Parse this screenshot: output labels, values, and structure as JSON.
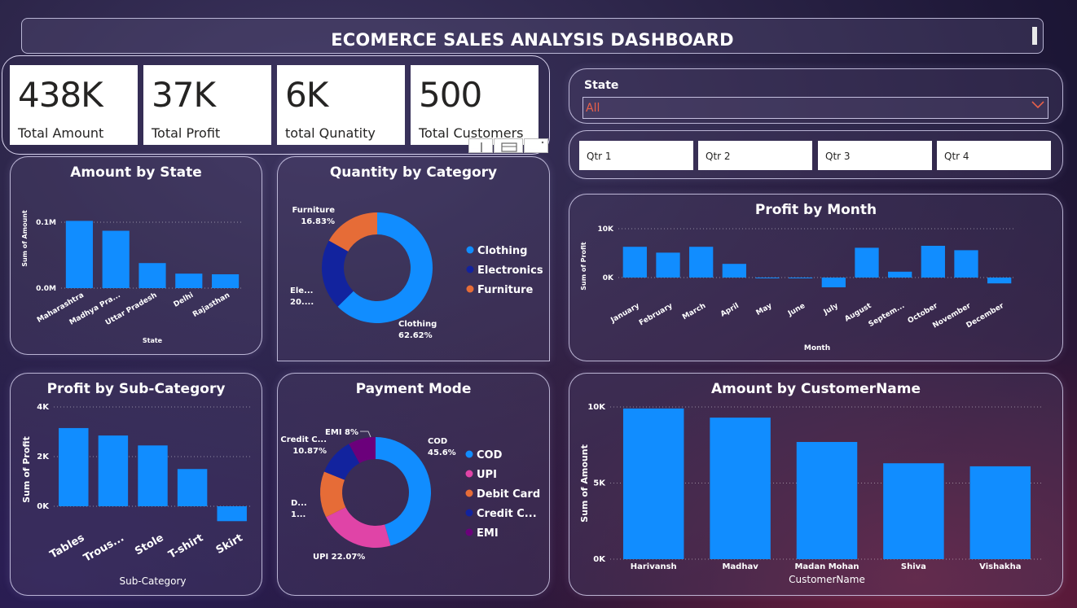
{
  "title": "ECOMERCE SALES ANALYSIS DASHBOARD",
  "kpis": [
    {
      "value": "438K",
      "label": "Total Amount"
    },
    {
      "value": "37K",
      "label": "Total Profit"
    },
    {
      "value": "6K",
      "label": "total Qunatity"
    },
    {
      "value": "500",
      "label": "Total Customers"
    }
  ],
  "state_slicer": {
    "label": "State",
    "selected": "All"
  },
  "quarters": [
    "Qtr 1",
    "Qtr 2",
    "Qtr 3",
    "Qtr 4"
  ],
  "colors": {
    "bar": "#118DFF",
    "clothing": "#118DFF",
    "electronics": "#12239E",
    "furniture": "#E66C37",
    "cod": "#118DFF",
    "upi": "#E044A7",
    "debit": "#E66C37",
    "credit": "#12239E",
    "emi": "#6B007B"
  },
  "chart_data": [
    {
      "id": "amount_by_state",
      "type": "bar",
      "title": "Amount by State",
      "xlabel": "State",
      "ylabel": "Sum of Amount",
      "categories": [
        "Maharashtra",
        "Madhya Pra...",
        "Uttar Pradesh",
        "Delhi",
        "Rajasthan"
      ],
      "values": [
        102000,
        87000,
        38000,
        22000,
        21000
      ],
      "yticks": [
        "0.0M",
        "0.1M"
      ],
      "ylim": [
        0,
        130000
      ]
    },
    {
      "id": "quantity_by_category",
      "type": "pie",
      "title": "Quantity by Category",
      "labels": [
        "Clothing",
        "Electronics",
        "Furniture"
      ],
      "values": [
        62.62,
        20.55,
        16.83
      ],
      "data_labels": [
        {
          "name": "Clothing",
          "pct": "62.62%"
        },
        {
          "name": "Ele...",
          "pct": "20...."
        },
        {
          "name": "Furniture",
          "pct": "16.83%"
        }
      ],
      "legend": [
        "Clothing",
        "Electronics",
        "Furniture"
      ]
    },
    {
      "id": "profit_by_month",
      "type": "bar",
      "title": "Profit by Month",
      "xlabel": "Month",
      "ylabel": "Sum of Profit",
      "categories": [
        "January",
        "February",
        "March",
        "April",
        "May",
        "June",
        "July",
        "August",
        "Septem...",
        "October",
        "November",
        "December"
      ],
      "values": [
        6300,
        5100,
        6300,
        2800,
        -150,
        -100,
        -2000,
        6100,
        1200,
        6500,
        5600,
        -1200
      ],
      "yticks": [
        "0K",
        "10K"
      ],
      "ylim": [
        -4000,
        10000
      ]
    },
    {
      "id": "profit_by_subcategory",
      "type": "bar",
      "title": "Profit by Sub-Category",
      "xlabel": "Sub-Category",
      "ylabel": "Sum of Profit",
      "categories": [
        "Tables",
        "Trous...",
        "Stole",
        "T-shirt",
        "Skirt"
      ],
      "values": [
        3150,
        2850,
        2450,
        1500,
        -600
      ],
      "yticks": [
        "0K",
        "2K",
        "4K"
      ],
      "ylim": [
        -1000,
        4000
      ]
    },
    {
      "id": "payment_mode",
      "type": "pie",
      "title": "Payment Mode",
      "labels": [
        "COD",
        "UPI",
        "Debit Card",
        "Credit Card",
        "EMI"
      ],
      "values": [
        45.6,
        22.07,
        13.46,
        10.87,
        8.0
      ],
      "data_labels": [
        {
          "name": "COD",
          "pct": "45.6%"
        },
        {
          "name": "UPI",
          "pct": "22.07%"
        },
        {
          "name": "D...",
          "pct": "1..."
        },
        {
          "name": "Credit C...",
          "pct": "10.87%"
        },
        {
          "name": "EMI",
          "pct": "8%"
        }
      ],
      "legend": [
        "COD",
        "UPI",
        "Debit Card",
        "Credit C...",
        "EMI"
      ]
    },
    {
      "id": "amount_by_customer",
      "type": "bar",
      "title": "Amount by CustomerName",
      "xlabel": "CustomerName",
      "ylabel": "Sum of Amount",
      "categories": [
        "Harivansh",
        "Madhav",
        "Madan Mohan",
        "Shiva",
        "Vishakha"
      ],
      "values": [
        9900,
        9300,
        7700,
        6300,
        6100
      ],
      "yticks": [
        "0K",
        "5K",
        "10K"
      ],
      "ylim": [
        0,
        10000
      ]
    }
  ]
}
